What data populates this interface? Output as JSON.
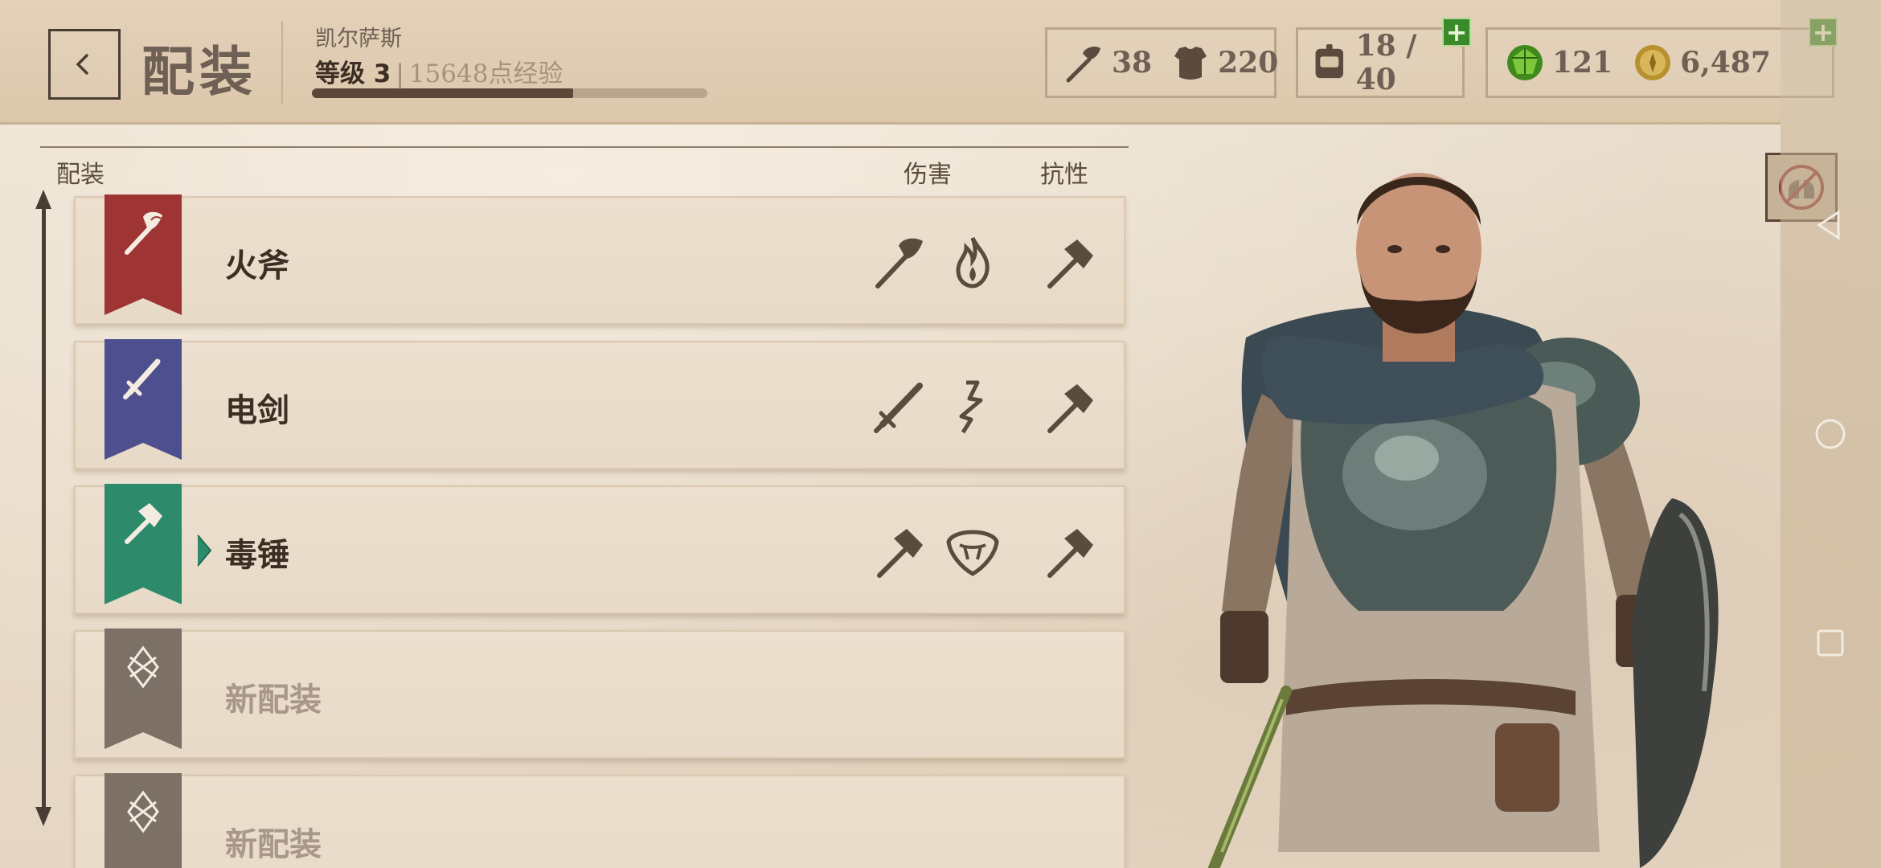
{
  "header": {
    "title": "配装",
    "character_name": "凯尔萨斯",
    "level_text": "等级 3",
    "xp_text": "15648点经验",
    "xp_progress": 0.66
  },
  "stats": {
    "weapons": "38",
    "armor": "220",
    "inventory": "18 / 40",
    "gems": "121",
    "gold": "6,487"
  },
  "list": {
    "col_loadout": "配装",
    "col_damage": "伤害",
    "col_resist": "抗性"
  },
  "loadouts": [
    {
      "name": "火斧",
      "banner_color": "#9e3534",
      "weapon_icon": "axe-icon",
      "damage_type_icon": "fire-icon",
      "resist_icon": "hammer-icon"
    },
    {
      "name": "电剑",
      "banner_color": "#4d4f8f",
      "weapon_icon": "sword-icon",
      "damage_type_icon": "lightning-icon",
      "resist_icon": "hammer-icon"
    },
    {
      "name": "毒锤",
      "banner_color": "#2d8a6b",
      "weapon_icon": "hammer-icon",
      "damage_type_icon": "poison-icon",
      "resist_icon": "hammer-icon",
      "selected": true
    },
    {
      "name": "新配装",
      "banner_color": "#7c7067",
      "weapon_icon": "empty-slot-icon",
      "empty": true
    },
    {
      "name": "新配装",
      "banner_color": "#7c7067",
      "weapon_icon": "empty-slot-icon",
      "empty": true
    }
  ],
  "colors": {
    "header_bg": "#dcc7ab",
    "text_dark": "#3c2e24",
    "plus_green": "#3b8a2a"
  }
}
